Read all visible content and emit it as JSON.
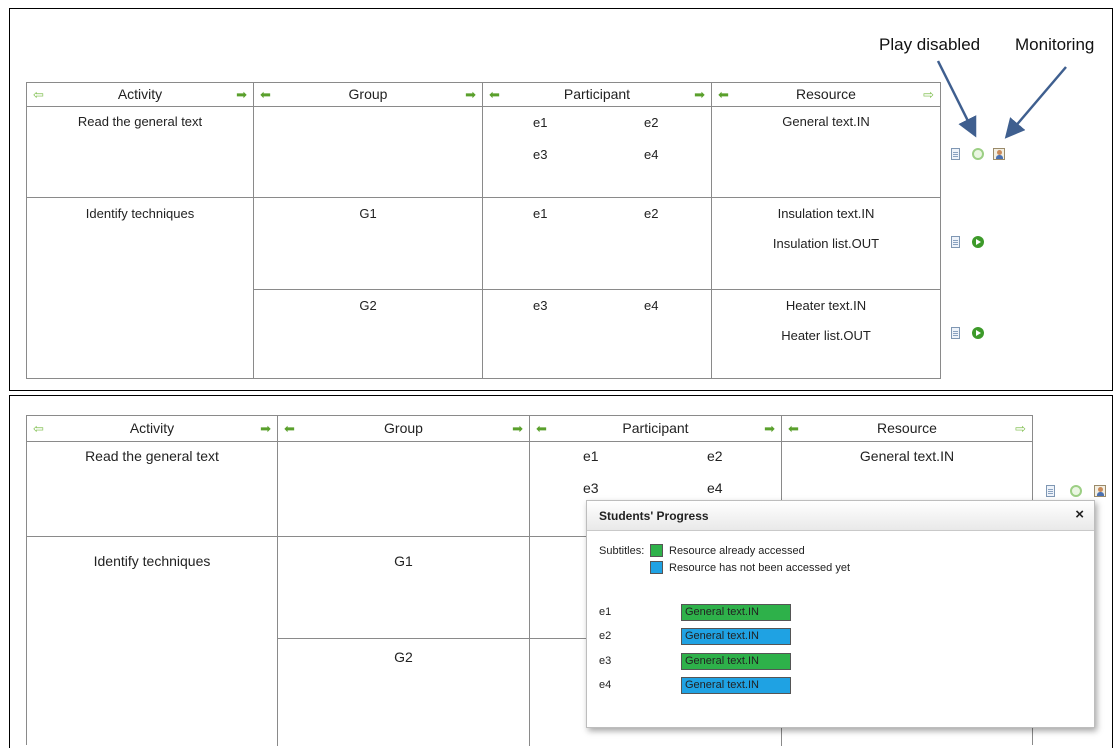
{
  "colors": {
    "accessed": "#2eb14a",
    "not_accessed": "#1fa2e3",
    "arrow": "#5aa02c"
  },
  "annotations": {
    "play_disabled": "Play disabled",
    "monitoring": "Monitoring"
  },
  "headers": {
    "activity": "Activity",
    "group": "Group",
    "participant": "Participant",
    "resource": "Resource"
  },
  "icons": {
    "left_arrow": "⇦",
    "right_arrow": "➡",
    "left_solid": "⬅",
    "right_hollow": "⇨"
  },
  "top": {
    "rows": [
      {
        "activity": "Read the general text",
        "group": "",
        "participants": [
          "e1",
          "e2",
          "e3",
          "e4"
        ],
        "resources": [
          "General text.IN"
        ]
      },
      {
        "activity": "Identify techniques",
        "group": "G1",
        "participants": [
          "e1",
          "e2"
        ],
        "resources": [
          "Insulation text.IN",
          "Insulation list.OUT"
        ]
      },
      {
        "activity": "",
        "group": "G2",
        "participants": [
          "e3",
          "e4"
        ],
        "resources": [
          "Heater text.IN",
          "Heater list.OUT"
        ]
      }
    ]
  },
  "bottom": {
    "rows": [
      {
        "activity": "Read the general text",
        "group": "",
        "participants": [
          "e1",
          "e2",
          "e3",
          "e4"
        ],
        "resources": [
          "General text.IN"
        ]
      },
      {
        "activity": "Identify techniques",
        "group": "G1"
      },
      {
        "activity": "",
        "group": "G2"
      }
    ]
  },
  "modal": {
    "title": "Students' Progress",
    "close": "×",
    "legend_label": "Subtitles:",
    "legend": [
      {
        "label": "Resource already accessed",
        "status": "accessed"
      },
      {
        "label": "Resource has not been accessed yet",
        "status": "not_accessed"
      }
    ],
    "students": [
      {
        "name": "e1",
        "resource": "General text.IN",
        "status": "accessed"
      },
      {
        "name": "e2",
        "resource": "General text.IN",
        "status": "not_accessed"
      },
      {
        "name": "e3",
        "resource": "General text.IN",
        "status": "accessed"
      },
      {
        "name": "e4",
        "resource": "General text.IN",
        "status": "not_accessed"
      }
    ]
  }
}
